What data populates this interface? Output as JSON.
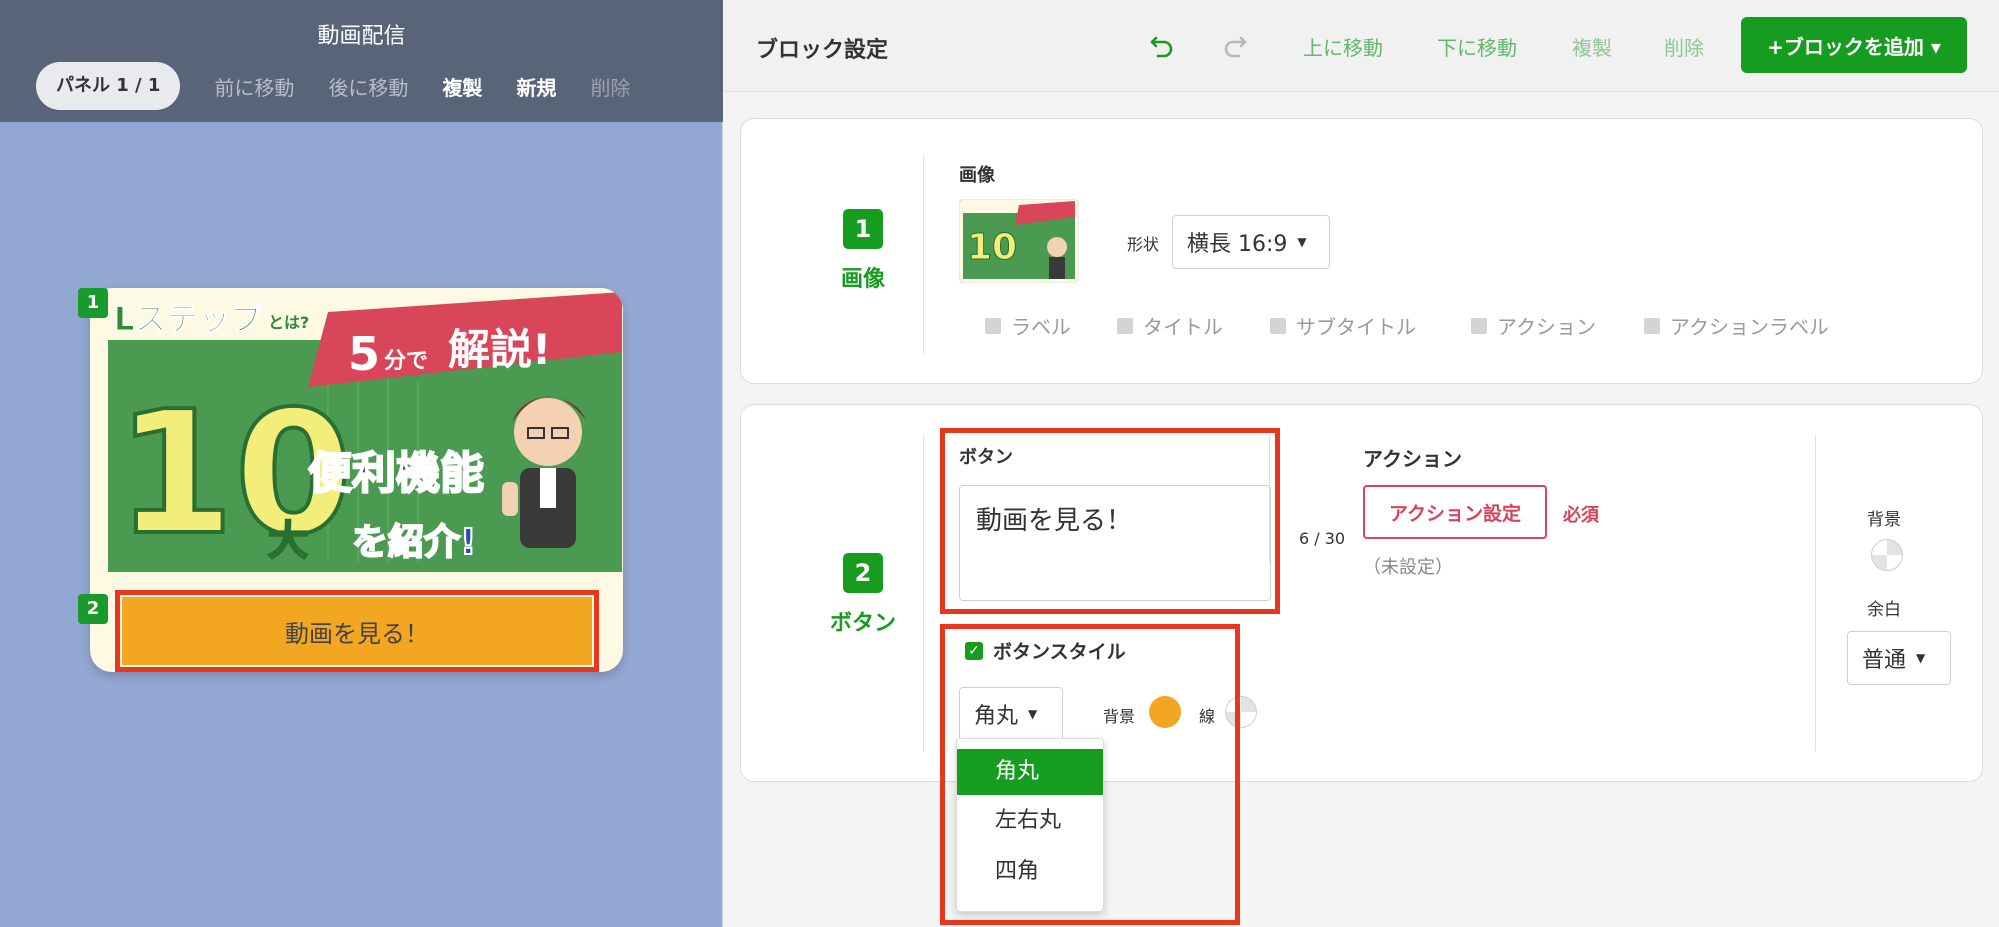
{
  "left": {
    "title": "動画配信",
    "panel_pill": "パネル 1 / 1",
    "actions": [
      "前に移動",
      "後に移動",
      "複製",
      "新規",
      "削除"
    ],
    "badges": [
      "1",
      "2"
    ],
    "preview_button_label": "動画を見る！",
    "hero": {
      "brand": "Lステップ",
      "brand_suffix": "とは?",
      "banner_text_1": "5",
      "banner_text_2": "分で",
      "banner_text_3": "解説!",
      "big_number": "10",
      "line1": "便利機能",
      "line2": "大",
      "line3": "を紹介!"
    }
  },
  "right": {
    "title": "ブロック設定",
    "toolbar": {
      "move_up": "上に移動",
      "move_down": "下に移動",
      "duplicate": "複製",
      "delete": "削除",
      "add_block": "+ブロックを追加 ▾"
    },
    "block1": {
      "number": "1",
      "name": "画像",
      "image_label": "画像",
      "shape_label": "形状",
      "shape_value": "横長 16:9",
      "options": [
        "ラベル",
        "タイトル",
        "サブタイトル",
        "アクション",
        "アクションラベル"
      ]
    },
    "block2": {
      "number": "2",
      "name": "ボタン",
      "button_label": "ボタン",
      "button_text": "動画を見る！",
      "char_count": "6 / 30",
      "action_label": "アクション",
      "action_button": "アクション設定",
      "required": "必須",
      "action_status": "（未設定）",
      "style_label": "ボタンスタイル",
      "style_value": "角丸",
      "bg_label": "背景",
      "line_label": "線",
      "right_bg_label": "背景",
      "margin_label": "余白",
      "margin_value": "普通",
      "dropdown_options": [
        "角丸",
        "左右丸",
        "四角"
      ]
    }
  },
  "colors": {
    "accent_green": "#169c1f",
    "highlight_red": "#e8371f",
    "button_orange": "#f2a622",
    "left_bg": "#93a7d3",
    "left_header": "#5a6479"
  }
}
